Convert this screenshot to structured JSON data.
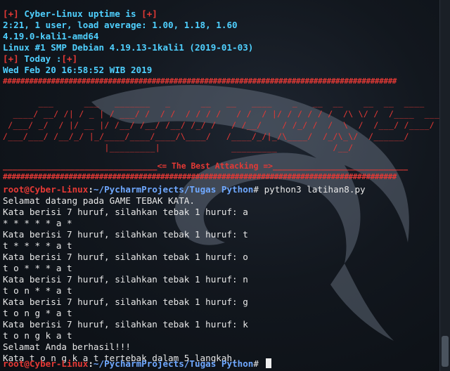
{
  "motd": {
    "uptime_prefix": "[+]",
    "uptime_title": " Cyber-Linux uptime is ",
    "uptime_suffix": "[+]",
    "uptime_value": "2:21, 1 user, load average: 1.00, 1.18, 1.60",
    "kernel": "4.19.0-kali1-amd64",
    "os_version": "Linux #1 SMP Debian 4.19.13-1kali1 (2019-01-03)",
    "today_prefix": "[+]",
    "today_title": " Today :",
    "today_suffix": "[+]",
    "date": "Wed Feb 20 16:58:52 WIB 2019",
    "hash_line": "##########################################################################################"
  },
  "banner": {
    "art": [
      "       ___      ___   _______   _      __   __   ____    _   __  __    __  __  ____",
      "  ____/ __/ /| / _ | / ___/ /  / /  / / / /   / /  / |/ / / / / /  /\\ \\/ /  /____  ______",
      " /___/ _/  / |/ __ |/ /__/ /__/ /__/ /_/ /   / /__/    / /_/ /  /  \\  /  /___/ /____/",
      "/___/___/ /__/_/ |_/____/____/____/\\____/   /____/_/|_/\\____/  /_/\\_\\/  /______/",
      "                    |_________|              _________           /__/"
    ],
    "tagline": "________________________________<= The Best Attacking =>____________________________"
  },
  "terminal": {
    "prompt_user": "root@Cyber-Linux",
    "prompt_sep": ":",
    "prompt_path": "~/PycharmProjects/Tugas Python",
    "prompt_symbol": "# ",
    "command": "python3 latihan8.py",
    "output": [
      "Selamat datang pada GAME TEBAK KATA.",
      "Kata berisi 7 huruf, silahkan tebak 1 huruf: a",
      "* * * * * a *",
      "Kata berisi 7 huruf, silahkan tebak 1 huruf: t",
      "t * * * * a t",
      "Kata berisi 7 huruf, silahkan tebak 1 huruf: o",
      "t o * * * a t",
      "Kata berisi 7 huruf, silahkan tebak 1 huruf: n",
      "t o n * * a t",
      "Kata berisi 7 huruf, silahkan tebak 1 huruf: g",
      "t o n g * a t",
      "Kata berisi 7 huruf, silahkan tebak 1 huruf: k",
      "t o n g k a t",
      "Selamat Anda berhasil!!!",
      "Kata t o n g k a t tertebak dalam 5 langkah."
    ]
  },
  "colors": {
    "accent_red": "#e53935",
    "accent_cyan": "#4fd0ff",
    "path_blue": "#6fa8ff",
    "background": "#0d1117"
  }
}
